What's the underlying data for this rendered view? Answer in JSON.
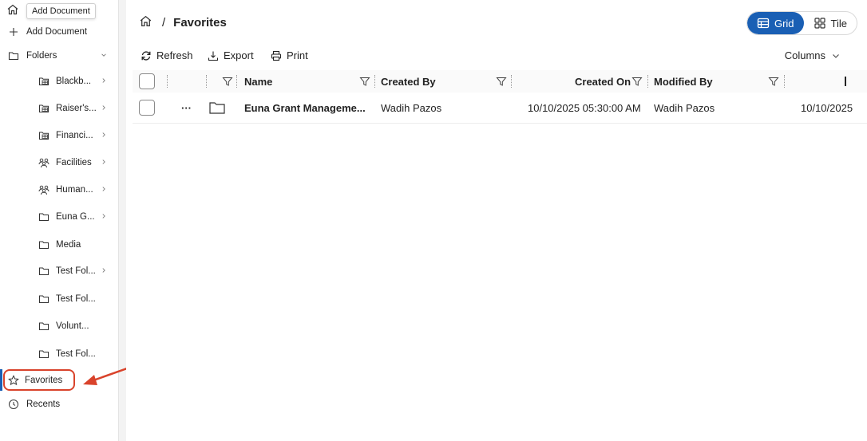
{
  "tooltip": "Add Document",
  "sidebar": {
    "add_document": "Add Document",
    "folders": "Folders",
    "items": [
      {
        "label": "Blackb..."
      },
      {
        "label": "Raiser's..."
      },
      {
        "label": "Financi..."
      },
      {
        "label": "Facilities"
      },
      {
        "label": "Human..."
      },
      {
        "label": "Euna G..."
      },
      {
        "label": "Media"
      },
      {
        "label": "Test Fol..."
      },
      {
        "label": "Test Fol..."
      },
      {
        "label": "Volunt..."
      },
      {
        "label": "Test Fol..."
      }
    ],
    "favorites": "Favorites",
    "recents": "Recents"
  },
  "breadcrumb": {
    "separator": "/",
    "current": "Favorites"
  },
  "view_toggle": {
    "grid": "Grid",
    "tile": "Tile",
    "active": "Grid"
  },
  "toolbar": {
    "refresh": "Refresh",
    "export": "Export",
    "print": "Print",
    "columns": "Columns"
  },
  "table": {
    "headers": {
      "name": "Name",
      "created_by": "Created By",
      "created_on": "Created On",
      "modified_by": "Modified By"
    },
    "rows": [
      {
        "actions": "···",
        "name": "Euna Grant Manageme...",
        "created_by": "Wadih Pazos",
        "created_on": "10/10/2025 05:30:00 AM",
        "modified_by": "Wadih Pazos",
        "modified_on": "10/10/2025"
      }
    ]
  },
  "colors": {
    "accent": "#1a5fb4",
    "highlight": "#d9432b"
  }
}
